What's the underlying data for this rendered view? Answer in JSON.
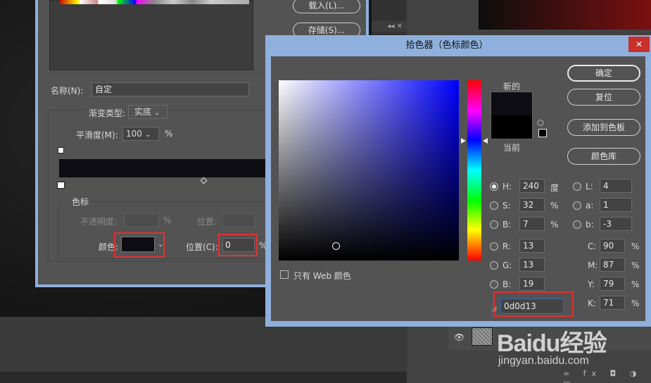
{
  "gradient_editor": {
    "load_button": "载入(L)...",
    "save_button": "存储(S)...",
    "name_label": "名称(N):",
    "name_value": "自定",
    "gradient_type_label": "渐变类型:",
    "gradient_type_value": "实底",
    "smoothness_label": "平滑度(M):",
    "smoothness_value": "100",
    "smoothness_unit": "%",
    "stops_group_label": "色标",
    "opacity_label": "不透明度:",
    "opacity_unit": "%",
    "opacity_location_label": "位置:",
    "opacity_location_unit": "%",
    "color_label": "颜色:",
    "location_label": "位置(C):",
    "location_value": "0",
    "location_unit": "%",
    "stop_color": "#0d0d13"
  },
  "color_picker": {
    "title": "拾色器（色标颜色）",
    "close_icon": "close-icon",
    "new_label": "新的",
    "current_label": "当前",
    "new_color": "#0d0d13",
    "current_color": "#000000",
    "buttons": {
      "ok": "确定",
      "reset": "复位",
      "add_to_swatches": "添加到色板",
      "color_libraries": "颜色库"
    },
    "hsb": {
      "h_label": "H:",
      "h_value": "240",
      "h_unit": "度",
      "s_label": "S:",
      "s_value": "32",
      "s_unit": "%",
      "b_label": "B:",
      "b_value": "7",
      "b_unit": "%"
    },
    "rgb": {
      "r_label": "R:",
      "r_value": "13",
      "g_label": "G:",
      "g_value": "13",
      "b_label": "B:",
      "b_value": "19"
    },
    "lab": {
      "l_label": "L:",
      "l_value": "4",
      "a_label": "a:",
      "a_value": "1",
      "b_label": "b:",
      "b_value": "-3"
    },
    "cmyk": {
      "c_label": "C:",
      "c_value": "90",
      "c_unit": "%",
      "m_label": "M:",
      "m_value": "87",
      "m_unit": "%",
      "y_label": "Y:",
      "y_value": "79",
      "y_unit": "%",
      "k_label": "K:",
      "k_value": "71",
      "k_unit": "%"
    },
    "hex_label": "#",
    "hex_value": "0d0d13",
    "web_only_label": "只有 Web 颜色",
    "selected_mode": "H"
  },
  "watermark": {
    "logo": "Baidu经验",
    "url": "jingyan.baidu.com"
  },
  "background": {
    "panel_collapse": "◂◂ ✕",
    "layer_tools": "∞ fx ◘ ◑ ▭"
  }
}
